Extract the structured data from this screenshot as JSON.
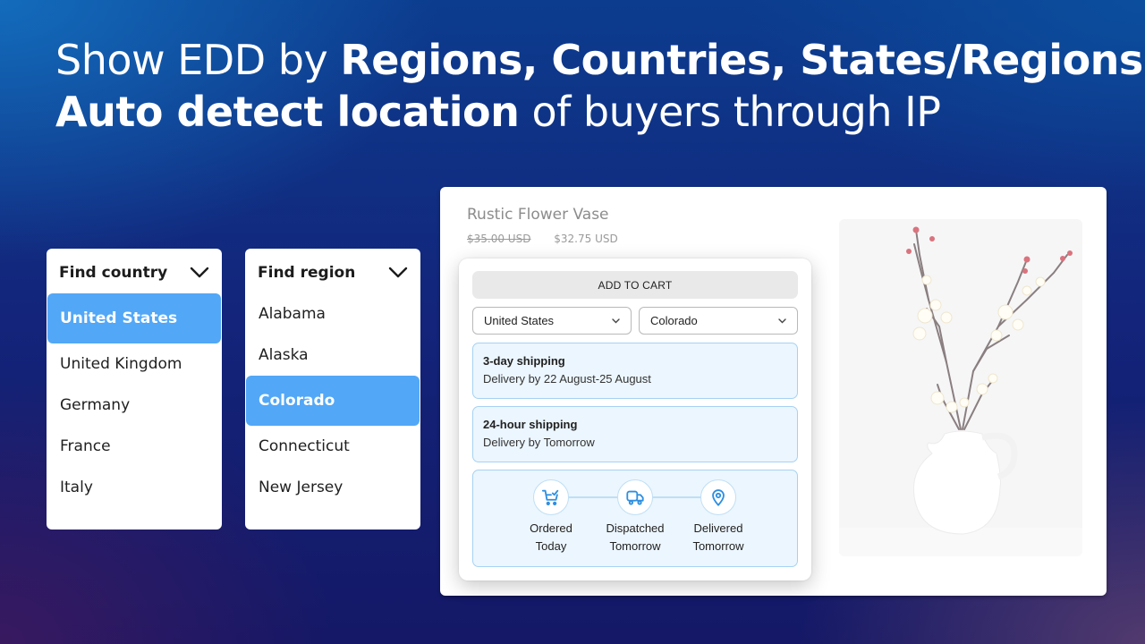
{
  "headline": {
    "line1_prefix": "Show EDD by ",
    "line1_bold": "Regions, Countries, States/Regions",
    "line2_bold": "Auto detect location",
    "line2_suffix": " of buyers through IP"
  },
  "country_dropdown": {
    "title": "Find country",
    "selected": "United States",
    "items": [
      "United States",
      "United Kingdom",
      "Germany",
      "France",
      "Italy"
    ]
  },
  "region_dropdown": {
    "title": "Find region",
    "selected": "Colorado",
    "items": [
      "Alabama",
      "Alaska",
      "Colorado",
      "Connecticut",
      "New Jersey"
    ]
  },
  "product": {
    "title": "Rustic Flower Vase",
    "old_price": "$35.00 USD",
    "price": "$32.75 USD",
    "image_alt": "White vase with cherry blossom branches"
  },
  "widget": {
    "add_to_cart": "ADD TO CART",
    "country_select": "United States",
    "region_select": "Colorado",
    "shipping_options": [
      {
        "name": "3-day shipping",
        "delivery": "Delivery by 22 August-25 August"
      },
      {
        "name": "24-hour shipping",
        "delivery": "Delivery by Tomorrow"
      }
    ],
    "timeline": [
      {
        "icon": "cart-check-icon",
        "label": "Ordered",
        "when": "Today"
      },
      {
        "icon": "truck-icon",
        "label": "Dispatched",
        "when": "Tomorrow"
      },
      {
        "icon": "location-pin-icon",
        "label": "Delivered",
        "when": "Tomorrow"
      }
    ]
  },
  "colors": {
    "selected_highlight": "#52a7f7",
    "timeline_accent": "#2f8fe0",
    "card_bg": "#ecf6fe",
    "card_border": "#a6d2f3"
  }
}
